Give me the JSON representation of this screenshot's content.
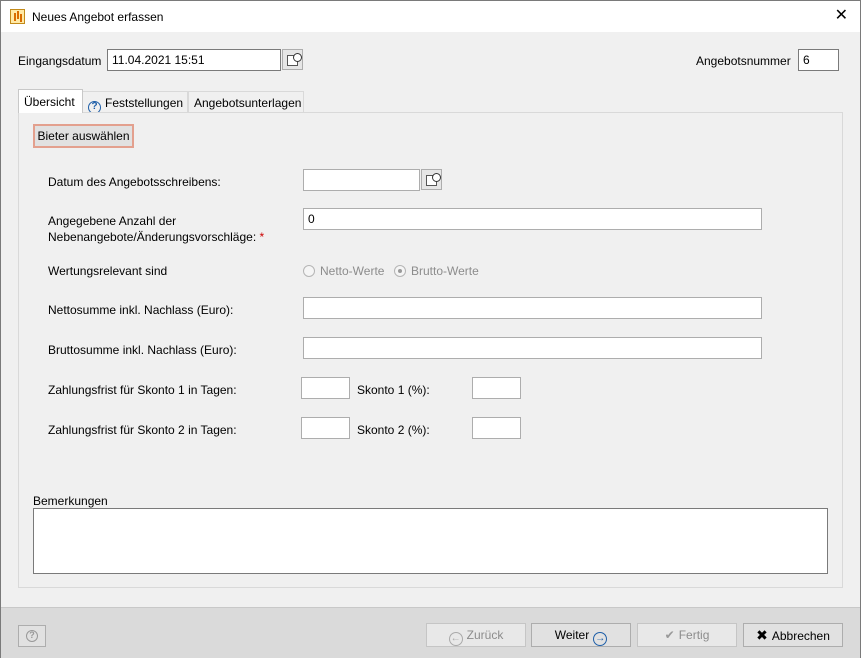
{
  "window": {
    "title": "Neues Angebot erfassen",
    "close_symbol": "✕"
  },
  "header": {
    "eingangsdatum_label": "Eingangsdatum",
    "eingangsdatum_value": "11.04.2021 15:51",
    "angebotsnummer_label": "Angebotsnummer",
    "angebotsnummer_value": "6"
  },
  "tabs": [
    {
      "label": "Übersicht"
    },
    {
      "label": "Feststellungen"
    },
    {
      "label": "Angebotsunterlagen"
    }
  ],
  "form": {
    "bieter_button": "Bieter auswählen",
    "datum_label": "Datum des Angebotsschreibens:",
    "datum_value": "",
    "anzahl_label_line1": "Angegebene Anzahl der",
    "anzahl_label_line2": "Nebenangebote/Änderungsvorschläge:",
    "anzahl_required": "*",
    "anzahl_value": "0",
    "wertung_label": "Wertungsrelevant sind",
    "netto_option": "Netto-Werte",
    "brutto_option": "Brutto-Werte",
    "netto_label": "Nettosumme inkl. Nachlass (Euro):",
    "brutto_label": "Bruttosumme inkl. Nachlass (Euro):",
    "frist1_label": "Zahlungsfrist für Skonto 1 in Tagen:",
    "skonto1_label": "Skonto 1 (%):",
    "frist2_label": "Zahlungsfrist für Skonto 2 in Tagen:",
    "skonto2_label": "Skonto 2 (%):",
    "bemerkungen_label": "Bemerkungen"
  },
  "footer": {
    "zurueck": "Zurück",
    "weiter": "Weiter",
    "fertig": "Fertig",
    "abbrechen": "Abbrechen"
  },
  "icons": {
    "app": "app-icon",
    "calendar": "calendar-icon",
    "help": "help-icon",
    "back": "arrow-left-icon",
    "forward": "arrow-right-icon",
    "check": "check-icon",
    "cancel": "x-icon"
  }
}
